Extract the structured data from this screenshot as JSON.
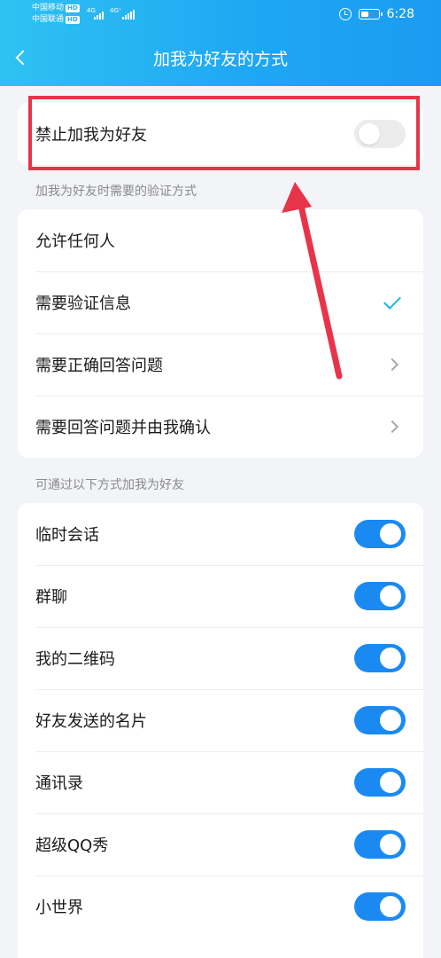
{
  "status_bar": {
    "carrier1": "中国移动",
    "carrier2": "中国联通",
    "hd": "HD",
    "net1": "4G",
    "net2": "4G⁺",
    "time": "6:28"
  },
  "header": {
    "title": "加我为好友的方式"
  },
  "forbid": {
    "label": "禁止加我为好友",
    "enabled": false
  },
  "verification": {
    "section_label": "加我为好友时需要的验证方式",
    "options": [
      {
        "label": "允许任何人",
        "indicator": "none"
      },
      {
        "label": "需要验证信息",
        "indicator": "check-icon"
      },
      {
        "label": "需要正确回答问题",
        "indicator": "chevron-right-icon"
      },
      {
        "label": "需要回答问题并由我确认",
        "indicator": "chevron-right-icon"
      }
    ]
  },
  "sources": {
    "section_label": "可通过以下方式加我为好友",
    "items": [
      {
        "label": "临时会话",
        "enabled": true
      },
      {
        "label": "群聊",
        "enabled": true
      },
      {
        "label": "我的二维码",
        "enabled": true
      },
      {
        "label": "好友发送的名片",
        "enabled": true
      },
      {
        "label": "通讯录",
        "enabled": true
      },
      {
        "label": "超级QQ秀",
        "enabled": true
      },
      {
        "label": "小世界",
        "enabled": true
      }
    ]
  },
  "colors": {
    "header_start": "#2ec2f2",
    "header_end": "#1a9cf2",
    "toggle_on": "#1a8af2",
    "check": "#18b7e6",
    "annotation": "#e8344a"
  }
}
